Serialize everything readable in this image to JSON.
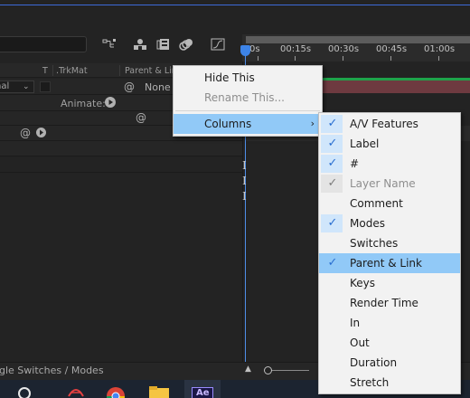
{
  "header": {
    "col_t": "T",
    "col_trkmat": ".TrkMat",
    "col_parent": "Parent & Link"
  },
  "layer": {
    "mode": "nal",
    "parent_value": "None",
    "animate_label": "Animate:"
  },
  "timeline": {
    "ticks": [
      "0s",
      "00:15s",
      "00:30s",
      "00:45s",
      "01:00s"
    ]
  },
  "bottom": {
    "toggle_label": "ggle Switches / Modes"
  },
  "context_menu": {
    "items": [
      {
        "label": "Hide This",
        "disabled": false
      },
      {
        "label": "Rename This...",
        "disabled": true
      },
      {
        "label": "Columns",
        "submenu": true,
        "highlighted": true
      }
    ]
  },
  "columns_menu": {
    "items": [
      {
        "label": "A/V Features",
        "checked": true
      },
      {
        "label": "Label",
        "checked": true
      },
      {
        "label": "#",
        "checked": true
      },
      {
        "label": "Layer Name",
        "checked": true,
        "disabled": true
      },
      {
        "label": "Comment",
        "checked": false
      },
      {
        "label": "Modes",
        "checked": true
      },
      {
        "label": "Switches",
        "checked": false
      },
      {
        "label": "Parent & Link",
        "checked": true,
        "highlighted": true
      },
      {
        "label": "Keys",
        "checked": false
      },
      {
        "label": "Render Time",
        "checked": false
      },
      {
        "label": "In",
        "checked": false
      },
      {
        "label": "Out",
        "checked": false
      },
      {
        "label": "Duration",
        "checked": false
      },
      {
        "label": "Stretch",
        "checked": false
      }
    ]
  },
  "taskbar": {
    "active_app": "Ae"
  },
  "colors": {
    "playhead": "#3d84e8",
    "work_area_green": "#1ea34a",
    "layer_bar": "#6e3a40",
    "menu_highlight": "#91c9f7",
    "check": "#2a6fd1"
  },
  "icons": [
    "flowchart-icon",
    "shy-layers-icon",
    "frame-blending-icon",
    "motion-blur-icon",
    "graph-editor-icon",
    "spiral-pickwhip-icon",
    "play-circle-icon",
    "search-taskbar-icon",
    "acrobat-icon",
    "chrome-icon",
    "folder-icon",
    "after-effects-icon"
  ]
}
